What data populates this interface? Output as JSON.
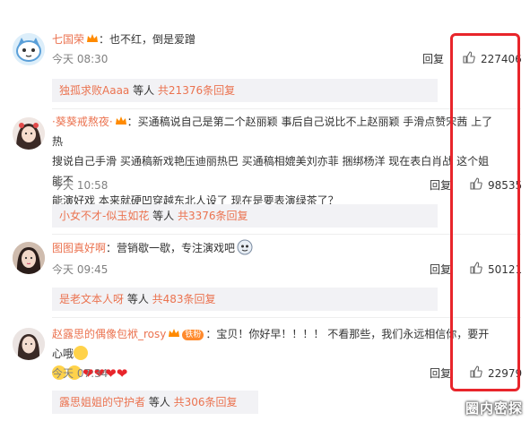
{
  "comments": [
    {
      "username": "七国荣",
      "text": "：也不红，倒是爱蹭",
      "time": "今天 08:30",
      "reply": "回复",
      "likes": "227406",
      "sub_user": "独孤求败Aaaa",
      "sub_mid": " 等人 ",
      "sub_total": "共21376条回复"
    },
    {
      "username": "·葵葵戒熬夜·",
      "text_line1": "：买通稿说自己是第二个赵丽颖  事后自己说比不上赵丽颖 手滑点赞宋茜 上了热",
      "text_line2": "搜说自己手滑 买通稿新戏艳压迪丽热巴 买通稿相媲美刘亦菲 捆绑杨洋 现在表白肖战 这个姐能不",
      "text_line3": "能演好戏 本来就硬凹穿越东北人设了 现在是要表演绿茶了？",
      "time": "今天 10:58",
      "reply": "回复",
      "likes": "98535",
      "sub_user": "小女不才-似玉如花",
      "sub_mid": " 等人 ",
      "sub_total": "共3376条回复"
    },
    {
      "username": "图图真好啊",
      "text": "：营销歇一歇，专注演戏吧",
      "time": "今天 09:45",
      "reply": "回复",
      "likes": "50121",
      "sub_user": "是老文本人呀",
      "sub_mid": " 等人 ",
      "sub_total": "共483条回复"
    },
    {
      "username": "赵露思的偶像包袱_rosy",
      "badge": "铁粉",
      "text": "：宝贝！你好早！！！！ 不看那些，我们永远相信你，要开心哦",
      "time": "今天 07:34",
      "reply": "回复",
      "likes": "22979",
      "sub_user": "露思姐姐的守护者",
      "sub_mid": " 等人 ",
      "sub_total": "共306条回复"
    }
  ],
  "watermark": "圈内密探",
  "colors": {
    "username": "#eb7350",
    "highlight_box": "#e8252b",
    "sub_bar_bg": "#f2f2f5"
  }
}
